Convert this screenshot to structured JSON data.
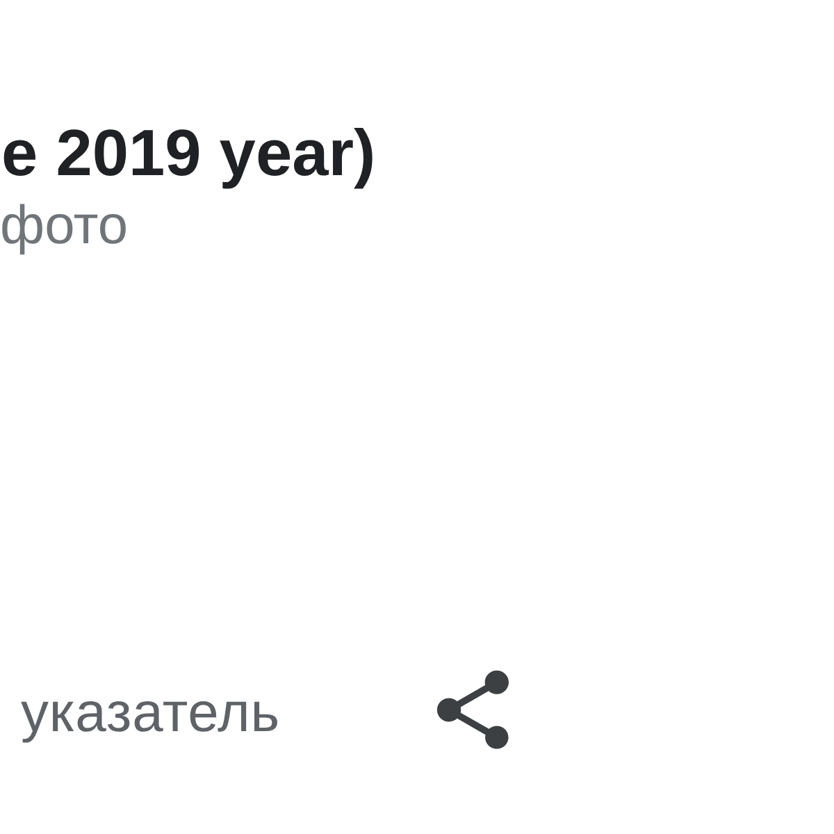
{
  "header": {
    "title": "e 2019 year)",
    "subtitle": "фото"
  },
  "action_row": {
    "label": "указатель"
  }
}
